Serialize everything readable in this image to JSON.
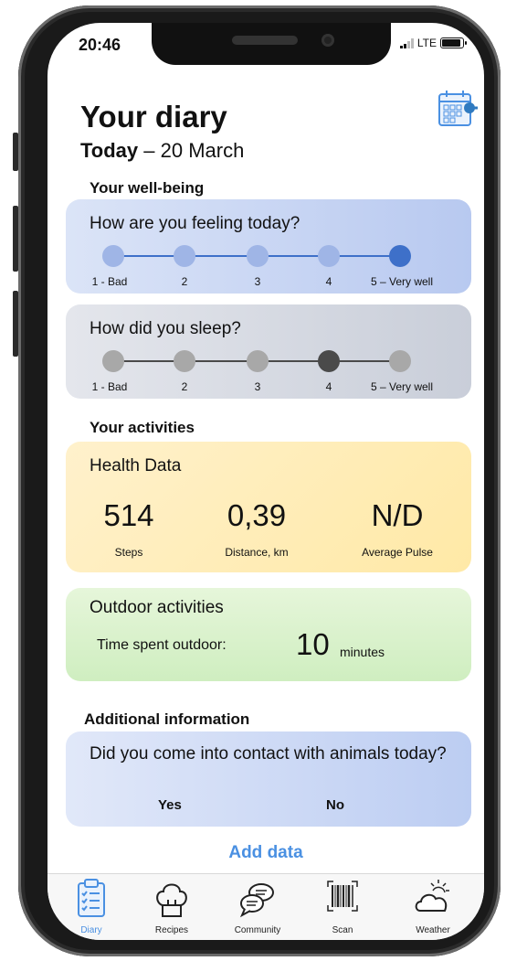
{
  "status": {
    "time": "20:46",
    "network": "LTE"
  },
  "header": {
    "title": "Your diary",
    "date_bold": "Today",
    "date_rest": " – 20 March"
  },
  "wellbeing": {
    "section": "Your well-being",
    "feeling": {
      "question": "How are you feeling today?",
      "labels": [
        "1 - Bad",
        "2",
        "3",
        "4",
        "5 – Very well"
      ],
      "selected": 5
    },
    "sleep": {
      "question": "How did you sleep?",
      "labels": [
        "1 - Bad",
        "2",
        "3",
        "4",
        "5 – Very well"
      ],
      "selected": 4
    }
  },
  "activities": {
    "section": "Your activities",
    "health": {
      "title": "Health Data",
      "metrics": [
        {
          "value": "514",
          "label": "Steps"
        },
        {
          "value": "0,39",
          "label": "Distance, km"
        },
        {
          "value": "N/D",
          "label": "Average Pulse"
        }
      ]
    },
    "outdoor": {
      "title": "Outdoor activities",
      "label": "Time spent outdoor:",
      "value": "10",
      "unit": "minutes"
    }
  },
  "additional": {
    "section": "Additional information",
    "question": "Did you come into contact with animals today?",
    "yes": "Yes",
    "no": "No"
  },
  "add_data": "Add data",
  "tabs": [
    {
      "label": "Diary",
      "icon": "clipboard-icon",
      "active": true
    },
    {
      "label": "Recipes",
      "icon": "chef-hat-icon",
      "active": false
    },
    {
      "label": "Community",
      "icon": "chat-bubbles-icon",
      "active": false
    },
    {
      "label": "Scan",
      "icon": "barcode-icon",
      "active": false
    },
    {
      "label": "Weather",
      "icon": "cloud-sun-icon",
      "active": false
    }
  ],
  "colors": {
    "accent": "#4a90e2",
    "feeling_dot": "#9fb5e6",
    "feeling_selected": "#3e70c9",
    "sleep_dot": "#a8a8a8",
    "sleep_selected": "#4a4a4a"
  }
}
